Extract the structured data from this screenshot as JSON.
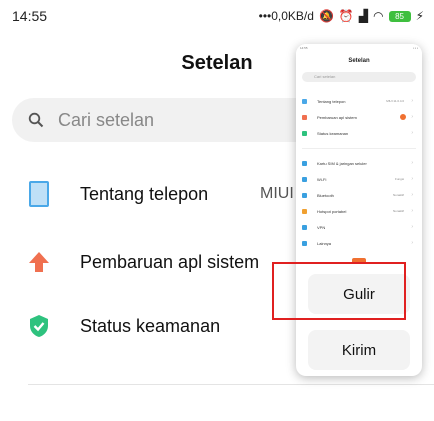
{
  "status_bar": {
    "time": "14:55",
    "network_speed": "0,0KB/d",
    "battery": "85"
  },
  "header": {
    "title": "Setelan"
  },
  "search": {
    "placeholder": "Cari setelan"
  },
  "settings": [
    {
      "label": "Tentang telepon",
      "value": "MIUI",
      "icon": "phone-icon",
      "color": "#4aa8e8"
    },
    {
      "label": "Pembaruan apl sistem",
      "icon": "update-arrow-icon",
      "color": "#f07050"
    },
    {
      "label": "Status keamanan",
      "icon": "shield-check-icon",
      "color": "#2ec27e"
    }
  ],
  "popup": {
    "preview": {
      "title": "Setelan",
      "search": "Cari setelan",
      "items": [
        {
          "label": "Tentang telepon",
          "value": "MIUI 11.0.4.0"
        },
        {
          "label": "Pembaruan apl sistem"
        },
        {
          "label": "Status keamanan"
        },
        {
          "label": "Kartu SIM & jaringan seluler"
        },
        {
          "label": "Wi-Fi",
          "value": "Fungsi"
        },
        {
          "label": "Bluetooth",
          "value": "Nonaktif"
        },
        {
          "label": "Hotspot portabel",
          "value": "Nonaktif"
        },
        {
          "label": "VPN"
        },
        {
          "label": "Lainnya"
        }
      ]
    },
    "scroll_button": "Gulir",
    "send_button": "Kirim"
  }
}
